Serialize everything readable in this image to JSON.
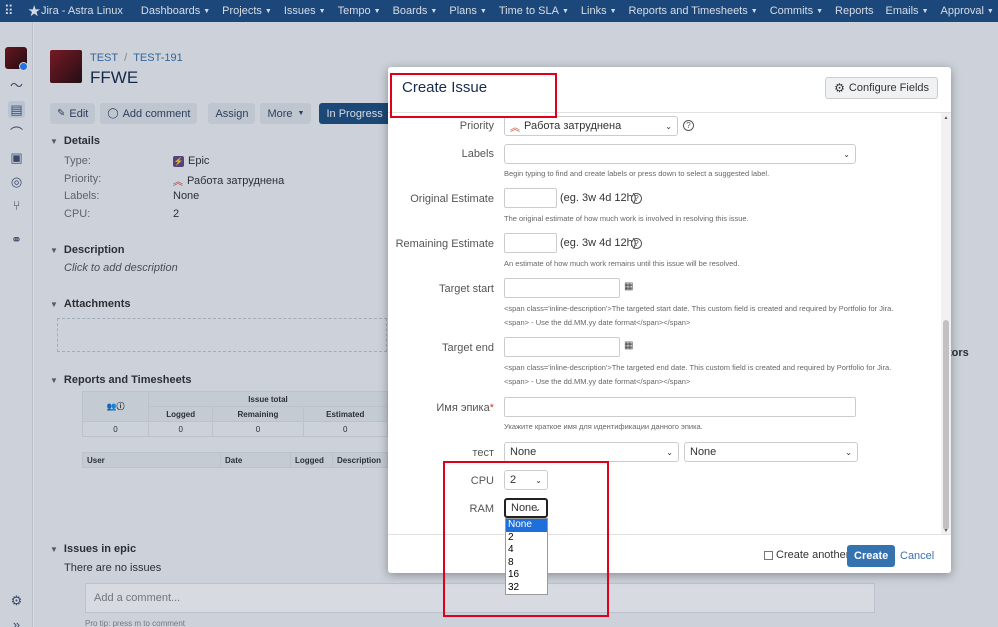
{
  "topbar": {
    "app_title": "Jira - Astra Linux",
    "menu": [
      "Dashboards",
      "Projects",
      "Issues",
      "Tempo",
      "Boards",
      "Plans",
      "Time to SLA",
      "Links",
      "Reports and Timesheets",
      "Commits",
      "Reports",
      "Emails",
      "Approval"
    ],
    "menu_caret": [
      true,
      true,
      true,
      true,
      true,
      true,
      true,
      true,
      true,
      true,
      false,
      true,
      true
    ]
  },
  "issue": {
    "project": "TEST",
    "key": "TEST-191",
    "title": "FFWE",
    "toolbar": {
      "edit": "Edit",
      "add_comment": "Add comment",
      "assign": "Assign",
      "more": "More",
      "status": "In Progress"
    },
    "details": {
      "heading": "Details",
      "type_label": "Type:",
      "type_value": "Epic",
      "priority_label": "Priority:",
      "priority_value": "Работа затруднена",
      "labels_label": "Labels:",
      "labels_value": "None",
      "cpu_label": "CPU:",
      "cpu_value": "2"
    },
    "description": {
      "heading": "Description",
      "hint": "Click to add description"
    },
    "attachments": {
      "heading": "Attachments"
    },
    "reports": {
      "heading": "Reports and Timesheets",
      "issue_total": "Issue total",
      "cols": [
        "Logged",
        "Remaining",
        "Estimated"
      ],
      "values": [
        "0",
        "0",
        "0",
        "0"
      ],
      "log_cols": [
        "User",
        "Date",
        "Logged",
        "Description"
      ]
    },
    "issues_in_epic": {
      "heading": "Issues in epic",
      "empty": "There are no issues"
    },
    "comment_placeholder": "Add a comment...",
    "pro_tip": "Pro tip: press  m  to comment",
    "right_fragment": "tors"
  },
  "dialog": {
    "title": "Create Issue",
    "configure_fields": "Configure Fields",
    "priority": {
      "label": "Priority",
      "value": "Работа затруднена"
    },
    "labels": {
      "label": "Labels",
      "hint": "Begin typing to find and create labels or press down to select a suggested label."
    },
    "original_estimate": {
      "label": "Original Estimate",
      "example": "(eg. 3w 4d 12h)",
      "hint": "The original estimate of how much work is involved in resolving this issue."
    },
    "remaining_estimate": {
      "label": "Remaining Estimate",
      "example": "(eg. 3w 4d 12h)",
      "hint": "An estimate of how much work remains until this issue will be resolved."
    },
    "target_start": {
      "label": "Target start",
      "hint1": "<span class='inline-description'>The targeted start date. This custom field is created and required by Portfolio for Jira.",
      "hint2": "<span> - Use the dd.MM.yy date format</span></span>"
    },
    "target_end": {
      "label": "Target end",
      "hint1": "<span class='inline-description'>The targeted end date. This custom field is created and required by Portfolio for Jira.",
      "hint2": "<span> - Use the dd.MM.yy date format</span></span>"
    },
    "epic_name": {
      "label": "Имя эпика",
      "required": "*",
      "hint": "Укажите краткое имя для идентификации данного эпика."
    },
    "test": {
      "label": "тест",
      "value1": "None",
      "value2": "None"
    },
    "cpu": {
      "label": "CPU",
      "value": "2"
    },
    "ram": {
      "label": "RAM",
      "value": "None",
      "options": [
        "None",
        "2",
        "4",
        "8",
        "16",
        "32"
      ]
    },
    "create_another": "Create another",
    "create": "Create",
    "cancel": "Cancel"
  },
  "colors": {
    "topbar": "#1f4f86",
    "primary_button": "#205081",
    "create_button": "#3572b0",
    "highlight_box": "#e0001b",
    "selected_option": "#1e6fd9"
  }
}
